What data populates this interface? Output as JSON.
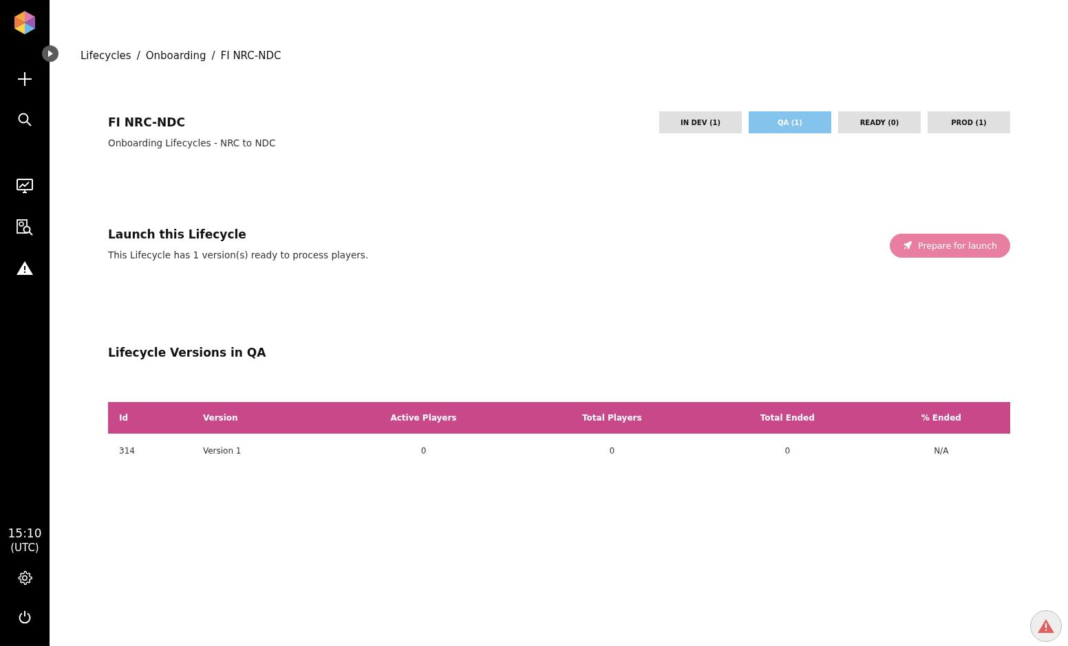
{
  "sidebar": {
    "time": "15:10",
    "timezone": "(UTC)"
  },
  "breadcrumb": [
    "Lifecycles",
    "Onboarding",
    "FI NRC-NDC"
  ],
  "breadcrumb_separator": "/",
  "header": {
    "title": "FI NRC-NDC",
    "subtitle": "Onboarding Lifecycles - NRC to NDC"
  },
  "stage_tabs": [
    {
      "label": "IN DEV (1)",
      "selected": false
    },
    {
      "label": "QA (1)",
      "selected": true
    },
    {
      "label": "READY (0)",
      "selected": false
    },
    {
      "label": "PROD (1)",
      "selected": false
    }
  ],
  "launch": {
    "title": "Launch this Lifecycle",
    "text": "This Lifecycle has 1 version(s) ready to process players.",
    "button": "Prepare for launch"
  },
  "versions": {
    "title": "Lifecycle Versions in QA",
    "columns": [
      "Id",
      "Version",
      "Active Players",
      "Total Players",
      "Total Ended",
      "% Ended"
    ],
    "rows": [
      [
        "314",
        "Version 1",
        "0",
        "0",
        "0",
        "N/A"
      ]
    ]
  }
}
